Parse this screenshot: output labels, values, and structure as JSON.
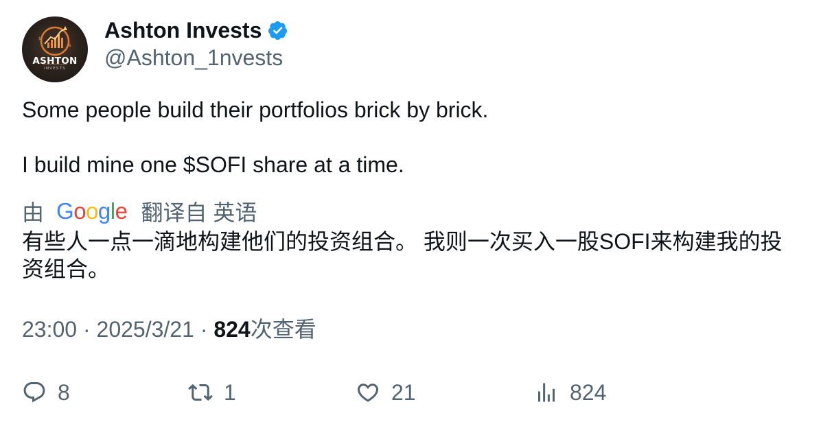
{
  "author": {
    "display_name": "Ashton Invests",
    "handle": "@Ashton_1nvests",
    "avatar_brand": "ASHTON",
    "avatar_subtitle": "INVESTS",
    "verified": true,
    "verified_color": "#1d9bf0"
  },
  "tweet": {
    "line1": "Some people build their portfolios brick by brick.",
    "line2": "I build mine one $SOFI share at a time."
  },
  "translation": {
    "by_label": "由",
    "provider": {
      "letters": [
        "G",
        "o",
        "o",
        "g",
        "l",
        "e"
      ]
    },
    "source_label": "翻译自 英语",
    "text": "有些人一点一滴地构建他们的投资组合。 我则一次买入一股SOFI来构建我的投资组合。"
  },
  "meta": {
    "time": "23:00",
    "separator": "·",
    "date": "2025/3/21",
    "views_count": "824",
    "views_label": "次查看"
  },
  "actions": {
    "replies": "8",
    "reposts": "1",
    "likes": "21",
    "views": "824"
  },
  "colors": {
    "text_primary": "#0f1419",
    "text_secondary": "#536471",
    "google_blue": "#4285f4",
    "google_red": "#ea4335",
    "google_yellow": "#fbbc05",
    "google_green": "#34a853"
  },
  "icons": {
    "reply": "speech-bubble-icon",
    "repost": "repost-arrows-icon",
    "like": "heart-icon",
    "views": "bar-chart-icon",
    "verified": "verified-badge-icon"
  }
}
